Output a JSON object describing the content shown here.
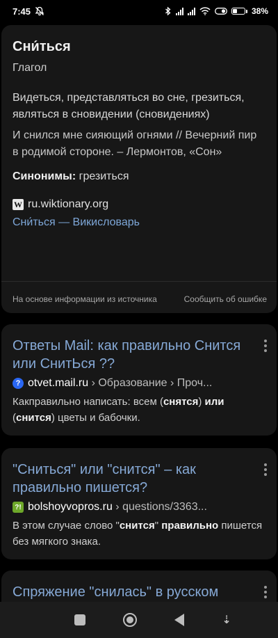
{
  "status_bar": {
    "time": "7:45",
    "battery_text": "38",
    "battery_level": 0.38
  },
  "knowledge_panel": {
    "title": "Сни́ться",
    "part_of_speech": "Глагол",
    "definition": "Видеться, представляться во сне, грезиться, являться в сновидении (сновидениях)",
    "example": "И снился мне сияющий огнями // Вечерний пир в родимой стороне. – Лермонтов, «Сон»",
    "synonyms_label": "Синонимы:",
    "synonyms_value": " грезиться",
    "source_icon": "W",
    "source_domain": "ru.wiktionary.org",
    "source_link": "Сни́ться — Викисловарь",
    "footer_left": "На основе информации из источника",
    "footer_right": "Сообщить об ошибке"
  },
  "results": [
    {
      "title": "Ответы Mail: как правильно Снится или СнитЬся ??",
      "favicon": "?",
      "domain": "otvet.mail.ru",
      "path": " › Образование › Проч...",
      "snippet_parts": [
        "Какправильно написать: всем (",
        "снятся",
        ") ",
        "или",
        " (",
        "снится",
        ") цветы и бабочки."
      ]
    },
    {
      "title": "\"Сниться\" или \"снится\" – как правильно пишется?",
      "favicon": "?!",
      "domain": "bolshoyvopros.ru",
      "path": " › questions/3363...",
      "snippet_parts": [
        "В этом случае слово \"",
        "снится",
        "\" ",
        "правильно",
        " пишется без мягкого знака."
      ]
    },
    {
      "title": "Спряжение \"снилась\" в русском"
    }
  ],
  "icons": {
    "mute": "bell-off-icon",
    "bluetooth": "bluetooth-icon",
    "wifi": "wifi-icon",
    "toggle": "toggle-icon"
  },
  "nav": {
    "extra_glyph": "⇣"
  }
}
